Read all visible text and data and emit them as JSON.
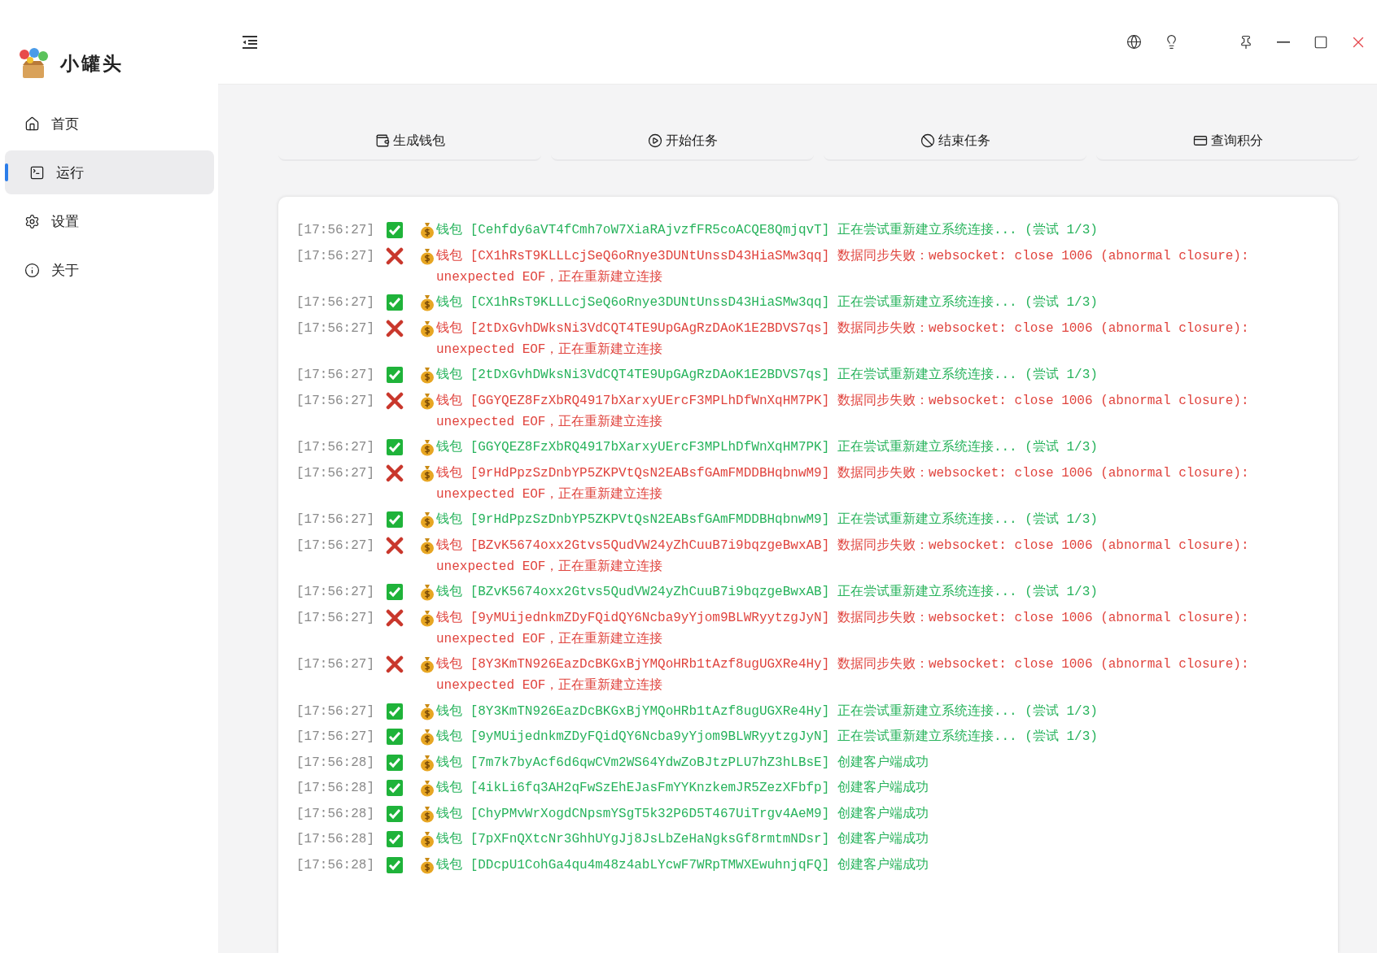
{
  "app": {
    "title": "小罐头"
  },
  "sidebar": {
    "items": [
      {
        "label": "首页",
        "selected": false
      },
      {
        "label": "运行",
        "selected": true
      },
      {
        "label": "设置",
        "selected": false
      },
      {
        "label": "关于",
        "selected": false
      }
    ]
  },
  "actions": [
    {
      "label": "生成钱包"
    },
    {
      "label": "开始任务"
    },
    {
      "label": "结束任务"
    },
    {
      "label": "查询积分"
    }
  ],
  "log": [
    {
      "kind": "ok",
      "time": "[17:56:27]",
      "wallet": "钱包",
      "address": "[Cehfdy6aVT4fCmh7oW7XiaRAjvzfFR5coACQE8QmjqvT]",
      "message": "正在尝试重新建立系统连接... (尝试 1/3)"
    },
    {
      "kind": "error",
      "time": "[17:56:27]",
      "wallet": "钱包",
      "address": "[CX1hRsT9KLLLcjSeQ6oRnye3DUNtUnssD43HiaSMw3qq]",
      "message": "数据同步失败：websocket: close 1006 (abnormal closure): unexpected EOF，正在重新建立连接"
    },
    {
      "kind": "ok",
      "time": "[17:56:27]",
      "wallet": "钱包",
      "address": "[CX1hRsT9KLLLcjSeQ6oRnye3DUNtUnssD43HiaSMw3qq]",
      "message": "正在尝试重新建立系统连接... (尝试 1/3)"
    },
    {
      "kind": "error",
      "time": "[17:56:27]",
      "wallet": "钱包",
      "address": "[2tDxGvhDWksNi3VdCQT4TE9UpGAgRzDAoK1E2BDVS7qs]",
      "message": "数据同步失败：websocket: close 1006 (abnormal closure): unexpected EOF，正在重新建立连接"
    },
    {
      "kind": "ok",
      "time": "[17:56:27]",
      "wallet": "钱包",
      "address": "[2tDxGvhDWksNi3VdCQT4TE9UpGAgRzDAoK1E2BDVS7qs]",
      "message": "正在尝试重新建立系统连接... (尝试 1/3)"
    },
    {
      "kind": "error",
      "time": "[17:56:27]",
      "wallet": "钱包",
      "address": "[GGYQEZ8FzXbRQ4917bXarxyUErcF3MPLhDfWnXqHM7PK]",
      "message": "数据同步失败：websocket: close 1006 (abnormal closure): unexpected EOF，正在重新建立连接"
    },
    {
      "kind": "ok",
      "time": "[17:56:27]",
      "wallet": "钱包",
      "address": "[GGYQEZ8FzXbRQ4917bXarxyUErcF3MPLhDfWnXqHM7PK]",
      "message": "正在尝试重新建立系统连接... (尝试 1/3)"
    },
    {
      "kind": "error",
      "time": "[17:56:27]",
      "wallet": "钱包",
      "address": "[9rHdPpzSzDnbYP5ZKPVtQsN2EABsfGAmFMDDBHqbnwM9]",
      "message": "数据同步失败：websocket: close 1006 (abnormal closure): unexpected EOF，正在重新建立连接"
    },
    {
      "kind": "ok",
      "time": "[17:56:27]",
      "wallet": "钱包",
      "address": "[9rHdPpzSzDnbYP5ZKPVtQsN2EABsfGAmFMDDBHqbnwM9]",
      "message": "正在尝试重新建立系统连接... (尝试 1/3)"
    },
    {
      "kind": "error",
      "time": "[17:56:27]",
      "wallet": "钱包",
      "address": "[BZvK5674oxx2Gtvs5QudVW24yZhCuuB7i9bqzgeBwxAB]",
      "message": "数据同步失败：websocket: close 1006 (abnormal closure): unexpected EOF，正在重新建立连接"
    },
    {
      "kind": "ok",
      "time": "[17:56:27]",
      "wallet": "钱包",
      "address": "[BZvK5674oxx2Gtvs5QudVW24yZhCuuB7i9bqzgeBwxAB]",
      "message": "正在尝试重新建立系统连接... (尝试 1/3)"
    },
    {
      "kind": "error",
      "time": "[17:56:27]",
      "wallet": "钱包",
      "address": "[9yMUijednkmZDyFQidQY6Ncba9yYjom9BLWRyytzgJyN]",
      "message": "数据同步失败：websocket: close 1006 (abnormal closure): unexpected EOF，正在重新建立连接"
    },
    {
      "kind": "error",
      "time": "[17:56:27]",
      "wallet": "钱包",
      "address": "[8Y3KmTN926EazDcBKGxBjYMQoHRb1tAzf8ugUGXRe4Hy]",
      "message": "数据同步失败：websocket: close 1006 (abnormal closure): unexpected EOF，正在重新建立连接"
    },
    {
      "kind": "ok",
      "time": "[17:56:27]",
      "wallet": "钱包",
      "address": "[8Y3KmTN926EazDcBKGxBjYMQoHRb1tAzf8ugUGXRe4Hy]",
      "message": "正在尝试重新建立系统连接... (尝试 1/3)"
    },
    {
      "kind": "ok",
      "time": "[17:56:27]",
      "wallet": "钱包",
      "address": "[9yMUijednkmZDyFQidQY6Ncba9yYjom9BLWRyytzgJyN]",
      "message": "正在尝试重新建立系统连接... (尝试 1/3)"
    },
    {
      "kind": "ok",
      "time": "[17:56:28]",
      "wallet": "钱包",
      "address": "[7m7k7byAcf6d6qwCVm2WS64YdwZoBJtzPLU7hZ3hLBsE]",
      "message": "创建客户端成功"
    },
    {
      "kind": "ok",
      "time": "[17:56:28]",
      "wallet": "钱包",
      "address": "[4ikLi6fq3AH2qFwSzEhEJasFmYYKnzkemJR5ZezXFbfp]",
      "message": "创建客户端成功"
    },
    {
      "kind": "ok",
      "time": "[17:56:28]",
      "wallet": "钱包",
      "address": "[ChyPMvWrXogdCNpsmYSgT5k32P6D5T467UiTrgv4AeM9]",
      "message": "创建客户端成功"
    },
    {
      "kind": "ok",
      "time": "[17:56:28]",
      "wallet": "钱包",
      "address": "[7pXFnQXtcNr3GhhUYgJj8JsLbZeHaNgksGf8rmtmNDsr]",
      "message": "创建客户端成功"
    },
    {
      "kind": "ok",
      "time": "[17:56:28]",
      "wallet": "钱包",
      "address": "[DDcpU1CohGa4qu4m48z4abLYcwF7WRpTMWXEwuhnjqFQ]",
      "message": "创建客户端成功"
    }
  ]
}
